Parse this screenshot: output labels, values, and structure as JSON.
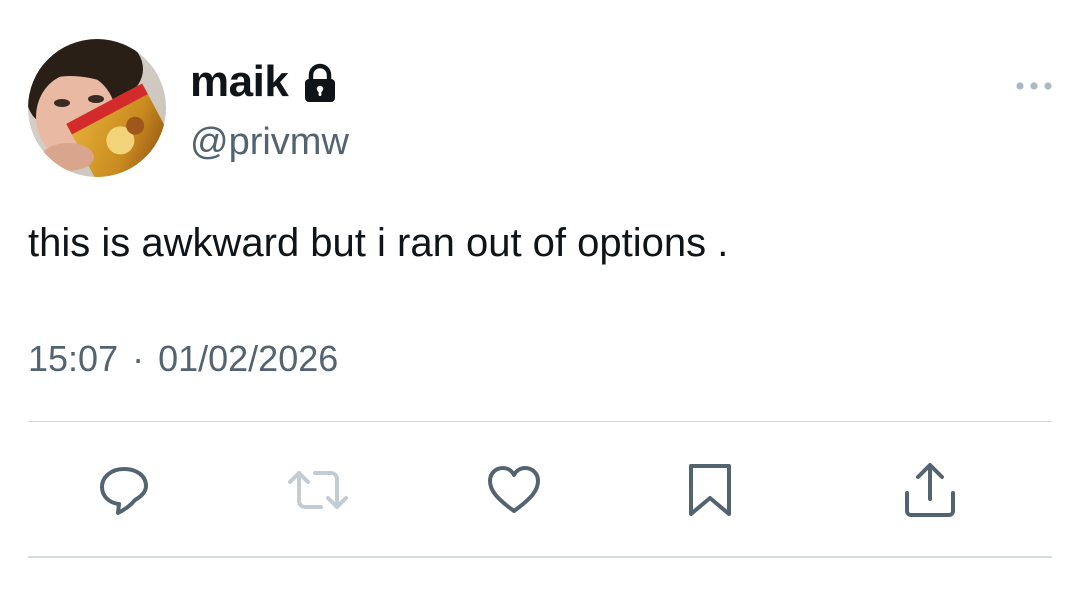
{
  "tweet": {
    "author": {
      "display_name": "maik",
      "handle": "@privmw",
      "protected": true,
      "avatar_icon": "user-avatar-photo"
    },
    "text": "this is awkward but i ran out of options .",
    "time": "15:07",
    "date": "01/02/2026",
    "separator": "·"
  },
  "icons": {
    "more": "more-horizontal-icon",
    "lock": "lock-icon",
    "reply": "reply-icon",
    "retweet": "retweet-icon",
    "like": "heart-icon",
    "bookmark": "bookmark-icon",
    "share": "share-icon"
  },
  "colors": {
    "text_primary": "#0f1419",
    "text_secondary": "#536471",
    "divider": "#cfd9de",
    "icon": "#536471"
  }
}
